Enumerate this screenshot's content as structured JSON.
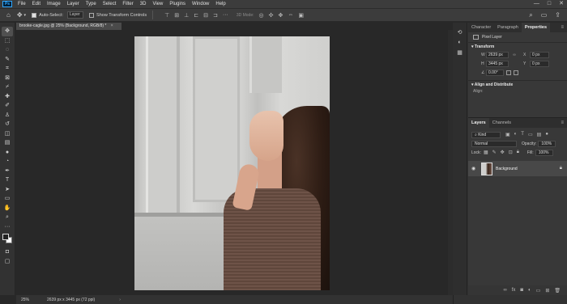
{
  "menubar": {
    "logo": "Ps",
    "items": [
      "File",
      "Edit",
      "Image",
      "Layer",
      "Type",
      "Select",
      "Filter",
      "3D",
      "View",
      "Plugins",
      "Window",
      "Help"
    ],
    "window_controls": [
      "—",
      "□",
      "✕"
    ]
  },
  "options": {
    "home_icon": "home-icon",
    "move_icon": "move-icon",
    "auto_select_label": "Auto-Select:",
    "auto_select_value": "Layer",
    "transform_label": "Show Transform Controls",
    "mode_3d_label": "3D Mode:"
  },
  "document": {
    "tab_title": "brooke-cagle.jpg @ 25% (Background, RGB/8) *",
    "tab_close": "×"
  },
  "status": {
    "zoom": "25%",
    "info": "2639 px x 3445 px (72 ppi)",
    "arrow": "›"
  },
  "properties": {
    "tabs": [
      "Character",
      "Paragraph",
      "Properties"
    ],
    "active_tab": "Properties",
    "pixel_layer_label": "Pixel Layer",
    "transform_label": "Transform",
    "w_label": "W",
    "w_value": "2639 px",
    "h_label": "H",
    "h_value": "3445 px",
    "x_label": "X",
    "x_value": "0 px",
    "y_label": "Y",
    "y_value": "0 px",
    "angle_value": "0.00°",
    "align_label": "Align and Distribute",
    "align_sub": "Align:"
  },
  "layers": {
    "tabs": [
      "Layers",
      "Channels"
    ],
    "active_tab": "Layers",
    "kind_value": "Kind",
    "blend_mode": "Normal",
    "opacity_label": "Opacity:",
    "opacity_value": "100%",
    "lock_label": "Lock:",
    "fill_label": "Fill:",
    "fill_value": "100%",
    "layer_name": "Background"
  },
  "colors": {
    "accent": "#31a8ff",
    "panel_bg": "#383838",
    "canvas_bg": "#282828"
  }
}
